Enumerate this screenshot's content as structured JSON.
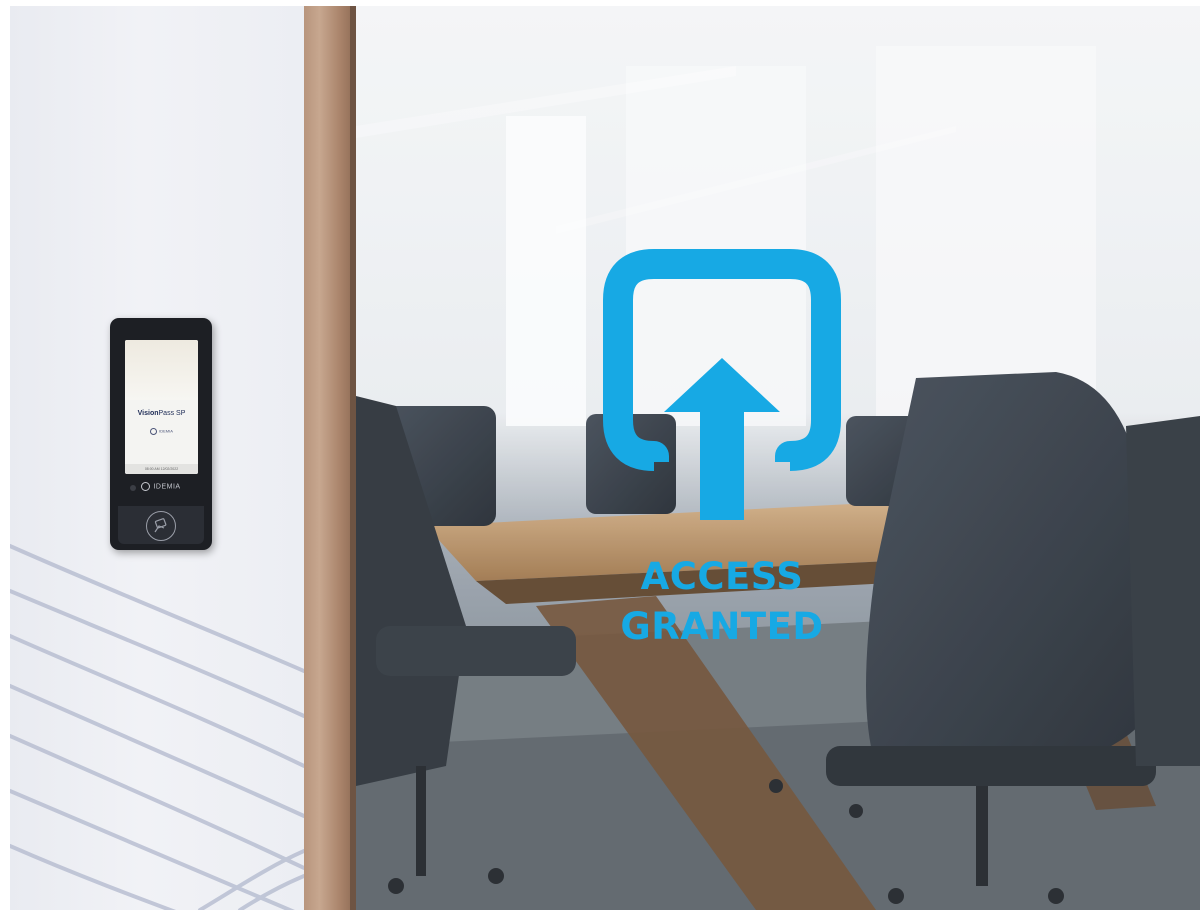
{
  "device": {
    "screen_brand_bold": "Vision",
    "screen_brand_regular": "Pass SP",
    "screen_logo": "IDEMIA",
    "screen_footer": "08:00 AM 12/02/2022",
    "bezel_logo": "IDEMIA"
  },
  "overlay": {
    "line1": "ACCESS",
    "line2": "GRANTED"
  },
  "colors": {
    "accent": "#17A9E4",
    "device_body": "#1D1F24",
    "door_frame": "#B8957D"
  },
  "icons": {
    "access": "square-frame-with-up-arrow",
    "contactless": "hand-card-tap"
  }
}
